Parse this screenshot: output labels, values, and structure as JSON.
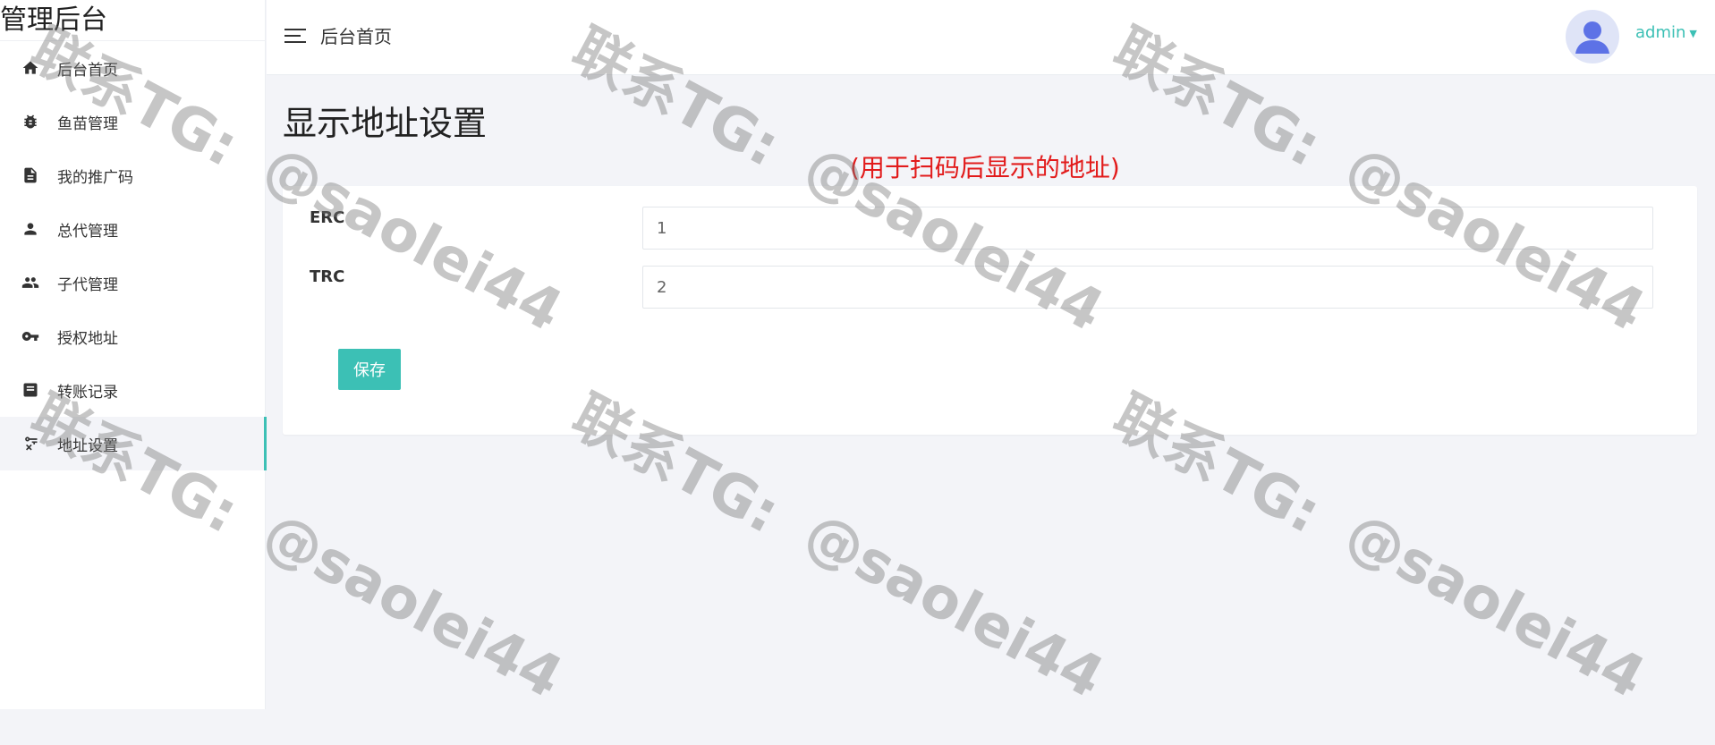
{
  "app": {
    "brand": "管理后台"
  },
  "header": {
    "breadcrumb": "后台首页",
    "user_name": "admin"
  },
  "sidebar": {
    "items": [
      {
        "label": "后台首页",
        "icon": "home-icon"
      },
      {
        "label": "鱼苗管理",
        "icon": "bug-icon"
      },
      {
        "label": "我的推广码",
        "icon": "document-icon"
      },
      {
        "label": "总代管理",
        "icon": "person-icon"
      },
      {
        "label": "子代管理",
        "icon": "people-icon"
      },
      {
        "label": "授权地址",
        "icon": "key-icon"
      },
      {
        "label": "转账记录",
        "icon": "receipt-icon"
      },
      {
        "label": "地址设置",
        "icon": "settings-key-icon",
        "active": true
      }
    ]
  },
  "main": {
    "title": "显示地址设置",
    "note": "(用于扫码后显示的地址)",
    "form": {
      "fields": [
        {
          "label": "ERC",
          "value": "1"
        },
        {
          "label": "TRC",
          "value": "2"
        }
      ],
      "save_label": "保存"
    }
  },
  "watermark": {
    "line1": "联系TG:",
    "line2": "@saolei44"
  },
  "colors": {
    "accent": "#3cc0b5",
    "note": "#e21b1b",
    "background": "#f3f4f8"
  }
}
